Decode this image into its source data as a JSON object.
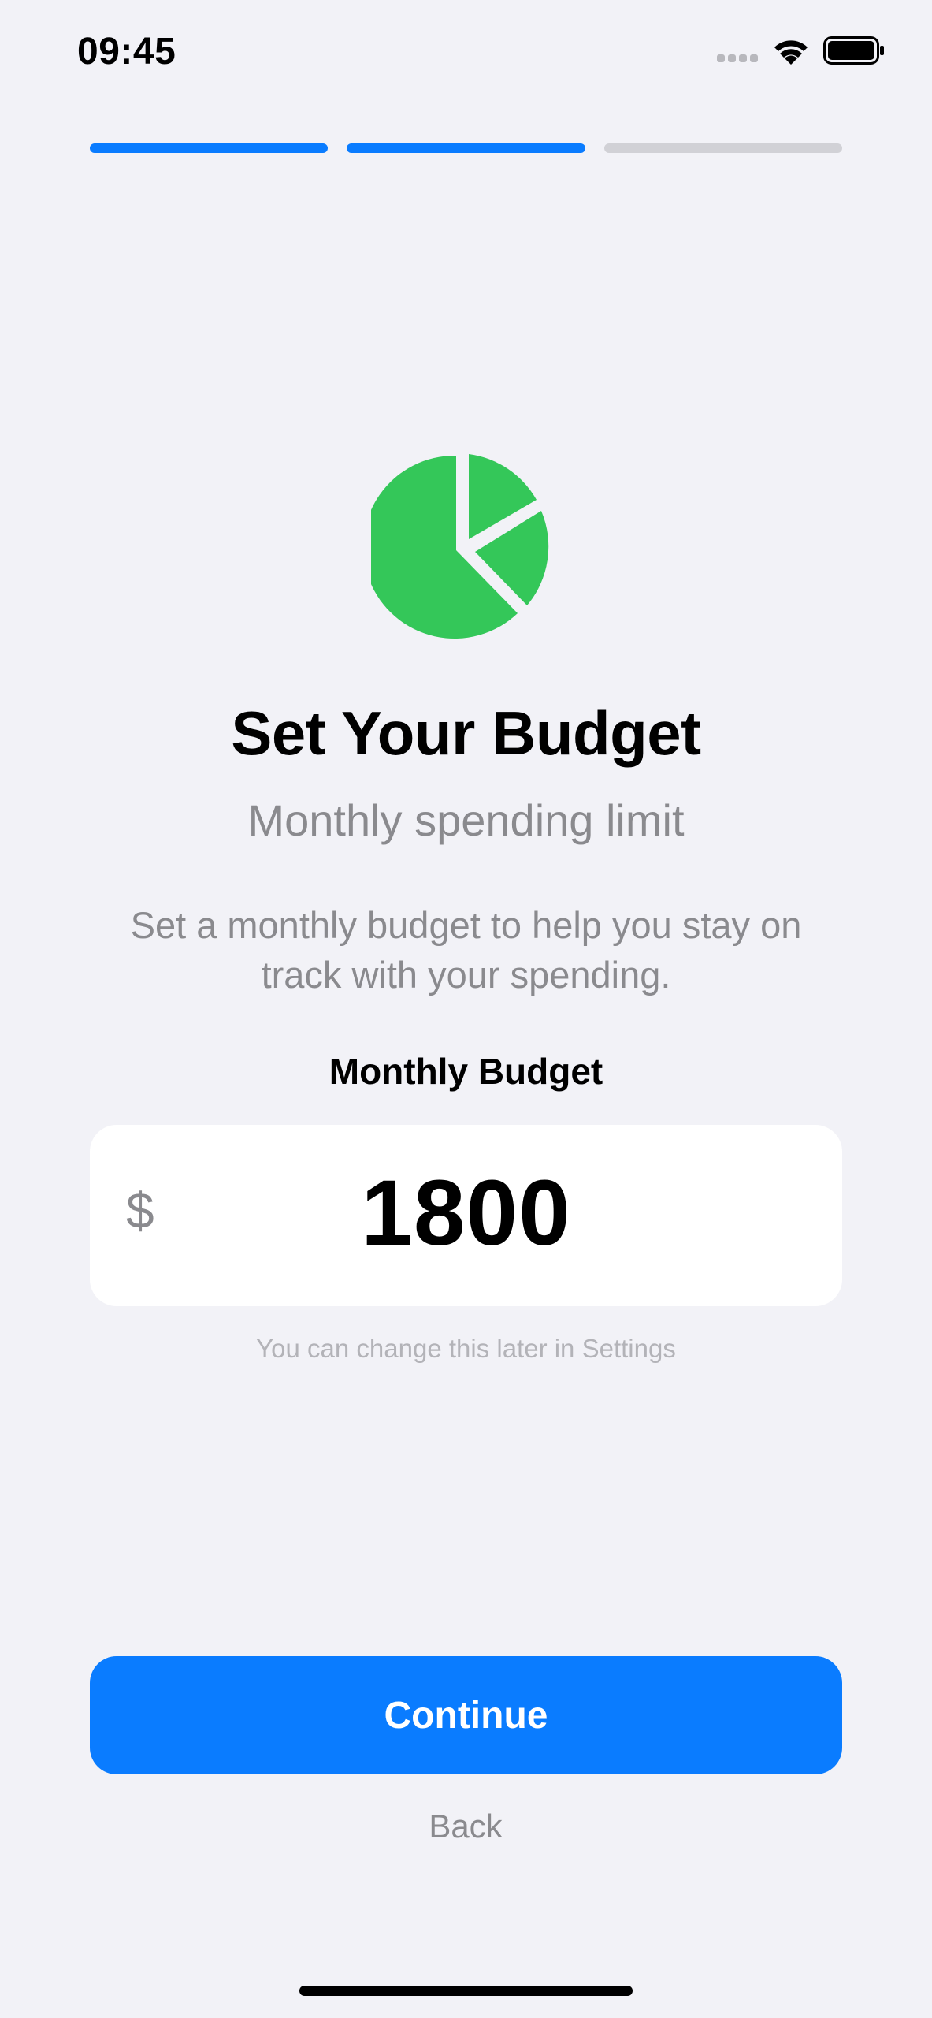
{
  "status_bar": {
    "time": "09:45"
  },
  "progress": {
    "total_steps": 3,
    "completed_steps": 2
  },
  "hero": {
    "icon": "chart-pie-icon",
    "color": "#34c759"
  },
  "title": "Set Your Budget",
  "subtitle": "Monthly spending limit",
  "description": "Set a monthly budget to help you stay on track with your spending.",
  "budget": {
    "label": "Monthly Budget",
    "currency_symbol": "$",
    "value": "1800",
    "hint": "You can change this later in Settings"
  },
  "actions": {
    "continue_label": "Continue",
    "back_label": "Back"
  },
  "colors": {
    "accent": "#0a7cff",
    "background": "#f2f2f7"
  }
}
